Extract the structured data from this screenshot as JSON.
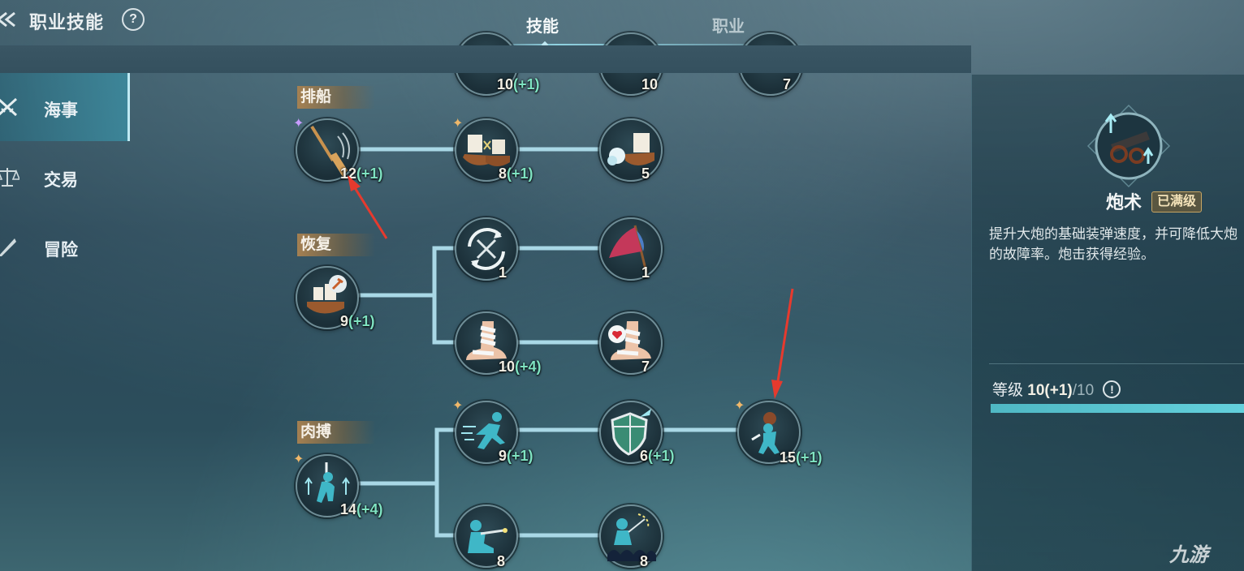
{
  "header": {
    "title": "职业技能",
    "help_label": "?",
    "tabs": [
      {
        "label": "技能",
        "active": true
      },
      {
        "label": "职业",
        "active": false
      }
    ]
  },
  "sidebar": {
    "items": [
      {
        "label": "海事",
        "icon": "crossed-swords-icon",
        "active": true
      },
      {
        "label": "交易",
        "icon": "balance-scale-icon",
        "active": false
      },
      {
        "label": "冒险",
        "icon": "quill-icon",
        "active": false
      }
    ]
  },
  "tree": {
    "categories": [
      "排船",
      "恢复",
      "肉搏"
    ],
    "top_partial_levels": [
      {
        "level": "10",
        "bonus": "(+1)"
      },
      {
        "level": "10",
        "bonus": ""
      },
      {
        "level": "7",
        "bonus": ""
      }
    ],
    "nodes": [
      {
        "id": "oar",
        "icon": "oar-icon",
        "level": "12",
        "bonus": "(+1)",
        "spark": "purple"
      },
      {
        "id": "ship-battle",
        "icon": "ship-battle-icon",
        "level": "8",
        "bonus": "(+1)",
        "spark": "gold"
      },
      {
        "id": "ship-fire",
        "icon": "ship-cannon-fire-icon",
        "level": "5",
        "bonus": "",
        "spark": ""
      },
      {
        "id": "ship-repair",
        "icon": "ship-repair-icon",
        "level": "9",
        "bonus": "(+1)",
        "spark": ""
      },
      {
        "id": "swords-cycle",
        "icon": "swords-cycle-icon",
        "level": "1",
        "bonus": "",
        "spark": ""
      },
      {
        "id": "flag",
        "icon": "flag-icon",
        "level": "1",
        "bonus": "",
        "spark": ""
      },
      {
        "id": "bandage",
        "icon": "bandaged-foot-icon",
        "level": "10",
        "bonus": "(+4)",
        "spark": ""
      },
      {
        "id": "bandage-heart",
        "icon": "bandaged-foot-heart-icon",
        "level": "7",
        "bonus": "",
        "spark": ""
      },
      {
        "id": "melee-boost",
        "icon": "sword-boost-icon",
        "level": "14",
        "bonus": "(+4)",
        "spark": "gold"
      },
      {
        "id": "sprint",
        "icon": "sprint-icon",
        "level": "9",
        "bonus": "(+1)",
        "spark": "gold"
      },
      {
        "id": "shield",
        "icon": "shield-icon",
        "level": "6",
        "bonus": "(+1)",
        "spark": ""
      },
      {
        "id": "throw",
        "icon": "throwing-icon",
        "level": "15",
        "bonus": "(+1)",
        "spark": "gold"
      },
      {
        "id": "shoot",
        "icon": "kneel-shoot-icon",
        "level": "8",
        "bonus": "",
        "spark": ""
      },
      {
        "id": "command",
        "icon": "command-crowd-icon",
        "level": "8",
        "bonus": "",
        "spark": ""
      }
    ]
  },
  "detail": {
    "icon": "cannon-icon",
    "name": "炮术",
    "badge": "已满级",
    "description": "提升大炮的基础装弹速度，并可降低大炮的故障率。炮击获得经验。",
    "level_label": "等级",
    "level_current": "10(+1)",
    "level_max": "/10",
    "info_label": "!",
    "level_fraction": 1.0
  },
  "watermark": "九游",
  "colors": {
    "accent": "#63d0dc",
    "bonus": "#7fe3c2",
    "category_bg": "#aa8250",
    "link_line": "#a9d8e6",
    "arrow": "#e63a2e"
  }
}
